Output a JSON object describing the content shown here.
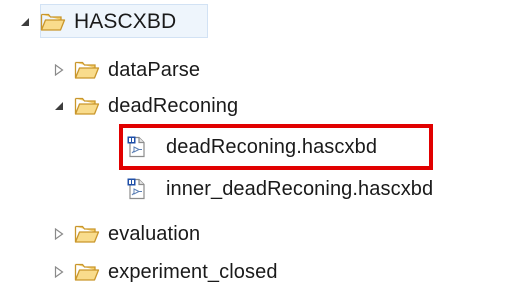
{
  "tree": {
    "root": {
      "label": "HASCXBD",
      "expanded": true,
      "icon": "folder-open-icon"
    },
    "items": [
      {
        "label": "dataParse",
        "expanded": false,
        "icon": "folder-open-icon"
      },
      {
        "label": "deadReconing",
        "expanded": true,
        "icon": "folder-open-icon"
      },
      {
        "label": "deadReconing.hascxbd",
        "icon": "hascxbd-file-icon",
        "highlighted": true
      },
      {
        "label": "inner_deadReconing.hascxbd",
        "icon": "hascxbd-file-icon",
        "highlighted": false
      },
      {
        "label": "evaluation",
        "expanded": false,
        "icon": "folder-open-icon"
      },
      {
        "label": "experiment_closed",
        "expanded": false,
        "icon": "folder-open-icon"
      }
    ]
  },
  "colors": {
    "folder_fill": "#f6cf6a",
    "folder_stroke": "#c9962b",
    "highlight_border": "#e10000",
    "root_selection": "#eef5fc",
    "twisty_expanded": "#3d3d3d",
    "twisty_collapsed": "#8a8a8a",
    "file_badge": "#1f4fa8"
  }
}
